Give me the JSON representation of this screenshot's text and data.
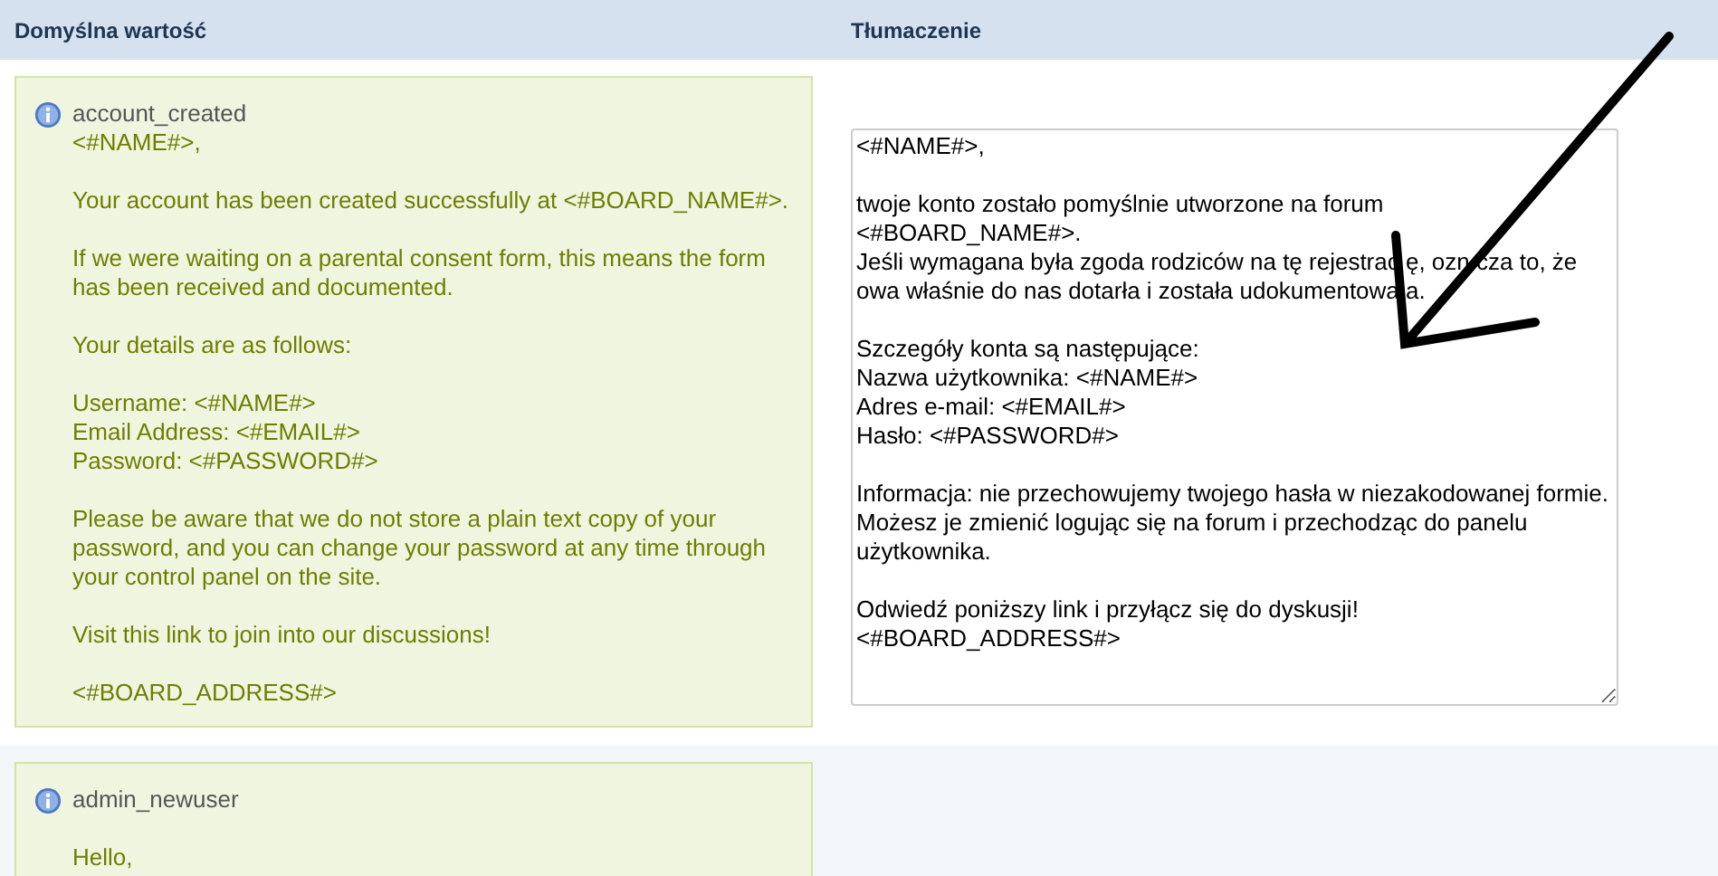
{
  "columns": [
    "Domyślna wartość",
    "Tłumaczenie"
  ],
  "rows": [
    {
      "key": "account_created",
      "paragraphs": [
        "<#NAME#>,",
        "Your account has been created successfully at <#BOARD_NAME#>.",
        "If we were waiting on a parental consent form, this means the form has been received and documented.",
        "Your details are as follows:",
        "Username: <#NAME#>\nEmail Address: <#EMAIL#>\nPassword: <#PASSWORD#>",
        "Please be aware that we do not store a plain text copy of your password, and you can change your password at any time through your control panel on the site.",
        "Visit this link to join into our discussions!",
        "<#BOARD_ADDRESS#>"
      ],
      "translation": "<#NAME#>,\n\ntwoje konto zostało pomyślnie utworzone na forum\n<#BOARD_NAME#>.\nJeśli wymagana była zgoda rodziców na tę rejestrac ę, ozn cza to, że owa właśnie do nas dotarła i została udokumentowa a.\n\nSzczegóły konta są następujące:\nNazwa użytkownika: <#NAME#>\nAdres e-mail: <#EMAIL#>\nHasło: <#PASSWORD#>\n\nInformacja: nie przechowujemy twojego hasła w niezakodowanej formie. Możesz je zmienić logując się na forum i przechodząc do panelu użytkownika.\n\nOdwiedź poniższy link i przyłącz się do dyskusji!\n<#BOARD_ADDRESS#>"
    },
    {
      "key": "admin_newuser",
      "paragraphs": [
        "Hello,"
      ]
    }
  ]
}
